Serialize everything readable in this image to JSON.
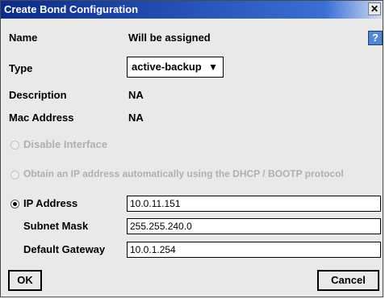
{
  "title": "Create Bond Configuration",
  "close_glyph": "✕",
  "help_glyph": "?",
  "fields": {
    "name_label": "Name",
    "name_value": "Will be assigned",
    "type_label": "Type",
    "type_value": "active-backup",
    "description_label": "Description",
    "description_value": "NA",
    "mac_label": "Mac Address",
    "mac_value": "NA"
  },
  "options": {
    "disable_interface": "Disable Interface",
    "dhcp": "Obtain an IP address automatically using the DHCP / BOOTP protocol",
    "ip_address": "IP Address"
  },
  "ip": {
    "ip_value": "10.0.11.151",
    "subnet_label": "Subnet Mask",
    "subnet_value": "255.255.240.0",
    "gateway_label": "Default Gateway",
    "gateway_value": "10.0.1.254"
  },
  "buttons": {
    "ok": "OK",
    "cancel": "Cancel"
  }
}
